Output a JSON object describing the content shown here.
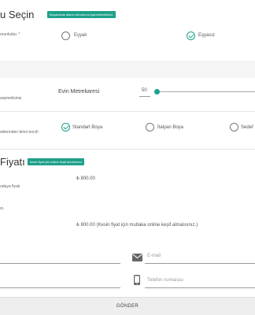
{
  "section1": {
    "title": "u Seçin",
    "badge": "Boyanacak alanın durumunu işaretlemelisiniz.",
    "question": "orunludur. *",
    "options": [
      {
        "label": "Eşyalı",
        "checked": false
      },
      {
        "label": "Eşyasız",
        "checked": true
      }
    ]
  },
  "area": {
    "hint": "sepmelisiniz.",
    "label": "Evin Metrekaresi",
    "value": "50",
    "slider_fraction": 0.0
  },
  "paint": {
    "hint": "eklerinden birini tercih",
    "options": [
      {
        "label": "Standart Boya",
        "checked": true
      },
      {
        "label": "İtalyan Boya",
        "checked": false
      },
      {
        "label": "Sedef",
        "checked": false
      }
    ]
  },
  "price": {
    "title": "Fiyatı",
    "badge": "kesin fiyat için online keşif almalısınız",
    "line1_hint": "odaya fiyatı",
    "line1_value": "₺ 800.00",
    "line2_hint": "ın.",
    "line2_value": "₺ 800.00 (Kesin fiyat için mutlaka online keşif almalısınız.)"
  },
  "form": {
    "email_placeholder": "E-mail",
    "phone_placeholder": "Telefon numarası",
    "submit_label": "GÖNDER"
  },
  "colors": {
    "accent": "#1ea08a"
  }
}
